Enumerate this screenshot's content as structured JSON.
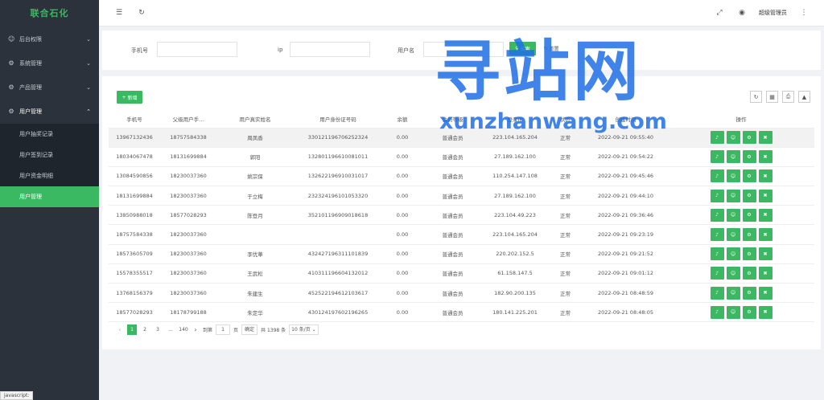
{
  "brand": "联合石化",
  "menu": [
    {
      "label": "后台权限",
      "icon": "user-icon",
      "open": false
    },
    {
      "label": "系统管理",
      "icon": "gear-icon",
      "open": false
    },
    {
      "label": "产品管理",
      "icon": "gear-icon",
      "open": false
    },
    {
      "label": "用户管理",
      "icon": "gear-icon",
      "open": true
    }
  ],
  "submenu": [
    {
      "label": "用户抽奖记录",
      "active": false
    },
    {
      "label": "用户签到记录",
      "active": false
    },
    {
      "label": "用户资金明细",
      "active": false
    },
    {
      "label": "用户管理",
      "active": true
    }
  ],
  "status_tip": "javascript:",
  "header": {
    "admin_name": "超级管理员",
    "icons": [
      "collapse-menu-icon",
      "refresh-icon",
      "fullscreen-icon",
      "globe-icon",
      "more-vertical-icon"
    ]
  },
  "search": {
    "phone_label": "手机号",
    "ip_label": "ip",
    "username_label": "用户名",
    "phone_value": "",
    "ip_value": "",
    "username_value": "",
    "search_button": "搜索",
    "reset_button": "重置"
  },
  "toolbar": {
    "add_button": "新增",
    "tool_icons": [
      "refresh-icon",
      "columns-icon",
      "print-icon",
      "export-icon"
    ]
  },
  "table": {
    "headers": [
      "手机号",
      "父级用户手...",
      "用户真实姓名",
      "用户身份证号码",
      "余额",
      "会员等级",
      "登录IP",
      "状态",
      "创建时间",
      "操作"
    ],
    "rows": [
      [
        "13967132436",
        "18757584338",
        "周凤香",
        "330121196706252324",
        "0.00",
        "普通会员",
        "223.104.165.204",
        "正常",
        "2022-09-21 09:55:40"
      ],
      [
        "18034067478",
        "18131699884",
        "郭阳",
        "132801196610081011",
        "0.00",
        "普通会员",
        "27.189.162.100",
        "正常",
        "2022-09-21 09:54:22"
      ],
      [
        "13084590856",
        "18230037360",
        "姚宗保",
        "132622196910031017",
        "0.00",
        "普通会员",
        "110.254.147.108",
        "正常",
        "2022-09-21 09:45:46"
      ],
      [
        "18131699884",
        "18230037360",
        "于立梅",
        "232324196101053320",
        "0.00",
        "普通会员",
        "27.189.162.100",
        "正常",
        "2022-09-21 09:44:10"
      ],
      [
        "13850988018",
        "18577028293",
        "陈登月",
        "352101196909018618",
        "0.00",
        "普通会员",
        "223.104.49.223",
        "正常",
        "2022-09-21 09:36:46"
      ],
      [
        "18757584338",
        "18230037360",
        "",
        "",
        "0.00",
        "普通会员",
        "223.104.165.204",
        "正常",
        "2022-09-21 09:23:19"
      ],
      [
        "18573605709",
        "18230037360",
        "李优華",
        "432427196311101839",
        "0.00",
        "普通会员",
        "220.202.152.5",
        "正常",
        "2022-09-21 09:21:52"
      ],
      [
        "15578355517",
        "18230037360",
        "王武松",
        "410311196604132012",
        "0.00",
        "普通会员",
        "61.158.147.5",
        "正常",
        "2022-09-21 09:01:12"
      ],
      [
        "13768156379",
        "18230037360",
        "朱建生",
        "452522194612103617",
        "0.00",
        "普通会员",
        "182.90.200.135",
        "正常",
        "2022-09-21 08:48:59"
      ],
      [
        "18577028293",
        "18178799188",
        "朱定华",
        "430124197602196265",
        "0.00",
        "普通会员",
        "180.141.225.201",
        "正常",
        "2022-09-21 08:48:05"
      ]
    ]
  },
  "pagination": {
    "pages": [
      "1",
      "2",
      "3",
      "...",
      "140"
    ],
    "current": "1",
    "goto_label": "到第",
    "goto_value": "1",
    "page_unit": "页",
    "confirm": "确定",
    "total": "共 1398 条",
    "page_size": "10 条/页"
  },
  "watermark": {
    "main": "寻站网",
    "sub": "xunzhanwang.com"
  },
  "colors": {
    "accent": "#3bb862",
    "sidebar_bg": "#2b323b",
    "watermark": "#1e6ee6"
  }
}
